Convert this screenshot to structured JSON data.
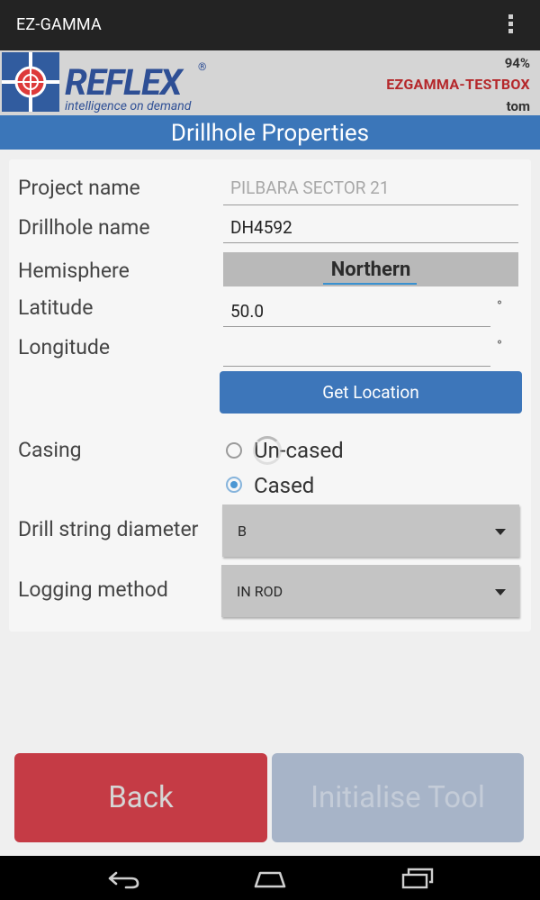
{
  "app_bar": {
    "title": "EZ-GAMMA",
    "menu_icon": "overflow-menu-icon"
  },
  "header": {
    "logo_text": "REFLEX",
    "logo_reg": "®",
    "logo_tagline": "intelligence on demand",
    "battery": "94%",
    "device": "EZGAMMA-TESTBOX",
    "user": "tom"
  },
  "title": "Drillhole Properties",
  "form": {
    "project_name_label": "Project name",
    "project_name_value": "PILBARA SECTOR 21",
    "drillhole_name_label": "Drillhole name",
    "drillhole_name_value": "DH4592",
    "hemisphere_label": "Hemisphere",
    "hemisphere_value": "Northern",
    "latitude_label": "Latitude",
    "latitude_value": "50.0",
    "longitude_label": "Longitude",
    "longitude_value": "",
    "degree_symbol": "°",
    "get_location_label": "Get Location",
    "casing_label": "Casing",
    "casing_options": [
      {
        "label": "Un-cased",
        "checked": false
      },
      {
        "label": "Cased",
        "checked": true
      }
    ],
    "drill_string_label": "Drill string diameter",
    "drill_string_value": "B",
    "logging_method_label": "Logging method",
    "logging_method_value": "IN ROD"
  },
  "buttons": {
    "back": "Back",
    "initialise": "Initialise Tool"
  },
  "nav": {
    "back_icon": "nav-back-icon",
    "home_icon": "nav-home-icon",
    "recents_icon": "nav-recents-icon"
  },
  "colors": {
    "accent_blue": "#3b76b9",
    "back_red": "#c53b45",
    "device_red": "#b5282b",
    "action_bar": "#232323"
  }
}
